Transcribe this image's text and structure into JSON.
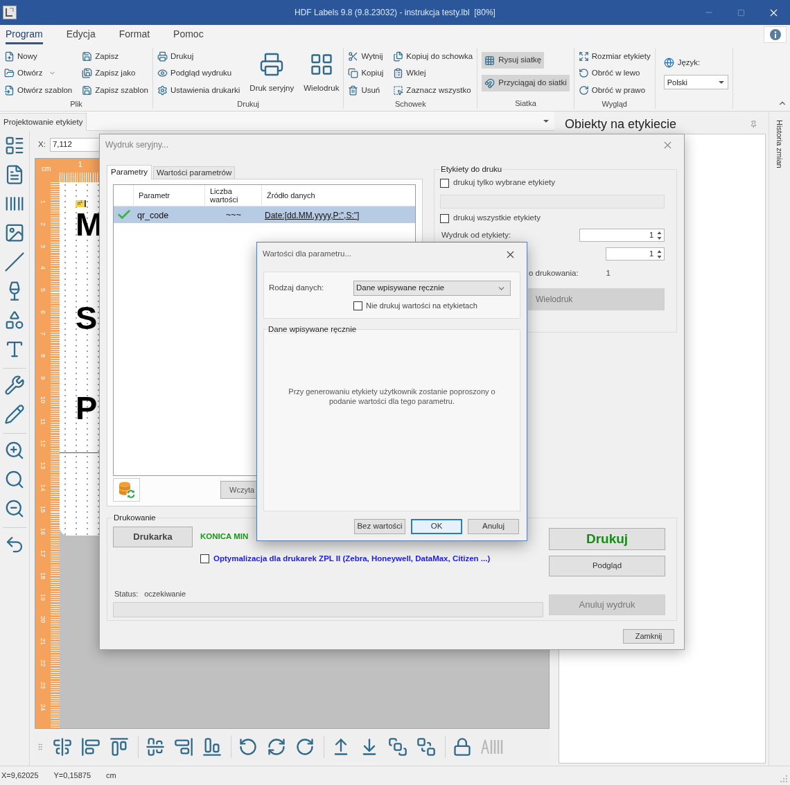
{
  "window": {
    "title": "HDF Labels 9.8 (9.8.23032) - instrukcja testy.lbl  [80%]"
  },
  "menu_tabs": [
    {
      "label": "Program",
      "selected": true
    },
    {
      "label": "Edycja",
      "selected": false
    },
    {
      "label": "Format",
      "selected": false
    },
    {
      "label": "Pomoc",
      "selected": false
    }
  ],
  "ribbon": [
    {
      "label": "Plik",
      "buttons": [
        {
          "kind": "small",
          "label": "Nowy"
        },
        {
          "kind": "split",
          "label": "Otwórz"
        },
        {
          "kind": "small",
          "label": "Otwórz szablon"
        },
        {
          "kind": "small",
          "label": "Zapisz"
        },
        {
          "kind": "small",
          "label": "Zapisz jako"
        },
        {
          "kind": "small",
          "label": "Zapisz szablon"
        }
      ]
    },
    {
      "label": "Drukuj",
      "buttons": [
        {
          "kind": "small",
          "label": "Drukuj"
        },
        {
          "kind": "small",
          "label": "Podgląd wydruku"
        },
        {
          "kind": "small",
          "label": "Ustawienia drukarki"
        },
        {
          "kind": "large",
          "label": "Druk seryjny"
        },
        {
          "kind": "large",
          "label": "Wielodruk"
        }
      ]
    },
    {
      "label": "Schowek",
      "buttons": [
        {
          "kind": "small",
          "label": "Wytnij"
        },
        {
          "kind": "small",
          "label": "Kopiuj"
        },
        {
          "kind": "small",
          "label": "Usuń"
        },
        {
          "kind": "small",
          "label": "Kopiuj do schowka"
        },
        {
          "kind": "small",
          "label": "Wklej"
        },
        {
          "kind": "small",
          "label": "Zaznacz wszystko"
        }
      ]
    },
    {
      "label": "Siatka",
      "buttons": [
        {
          "kind": "toggle",
          "label": "Rysuj siatkę",
          "on": true
        },
        {
          "kind": "toggle",
          "label": "Przyciągaj do siatki",
          "on": true
        }
      ]
    },
    {
      "label": "Wygląd",
      "buttons": [
        {
          "kind": "small",
          "label": "Rozmiar etykiety"
        },
        {
          "kind": "small",
          "label": "Obróć w lewo"
        },
        {
          "kind": "small",
          "label": "Obróć w prawo"
        }
      ]
    }
  ],
  "language": {
    "label": "Język:",
    "value": "Polski"
  },
  "document_tabs": [
    {
      "label": "Projektowanie etykiety",
      "selected": true
    }
  ],
  "coordinates": {
    "label": "X:",
    "value": "7,112"
  },
  "ruler": {
    "unit": "cm",
    "top_marks": [
      "1"
    ],
    "side_marks": [
      "1",
      "2",
      "3",
      "4",
      "5",
      "6",
      "7",
      "8",
      "9",
      "10",
      "11",
      "12",
      "13",
      "14",
      "15",
      "16",
      "17",
      "18",
      "19",
      "20",
      "21",
      "22",
      "23",
      "24"
    ]
  },
  "label_preview": {
    "tag": "rt$^{1}$",
    "lines": [
      "M",
      "S",
      "P"
    ]
  },
  "objects_panel": {
    "title": "Obiekty na etykiecie"
  },
  "side_tabs": [
    {
      "label": "Historia zmian"
    }
  ],
  "serial_print_dialog": {
    "title": "Wydruk seryjny...",
    "tabs": [
      {
        "label": "Parametry",
        "selected": true
      },
      {
        "label": "Wartości parametrów",
        "selected": false
      }
    ],
    "table": {
      "columns": [
        "Parametr",
        "Liczba wartości",
        "Źródło danych"
      ],
      "rows": [
        {
          "valid": true,
          "selected": true,
          "cells": [
            "qr_code",
            "~~~",
            "Date:[dd.MM.yyyy,P:\",S:\"]"
          ]
        }
      ]
    },
    "load_button": "Wczyta",
    "labels_group": {
      "title": "Etykiety do druku",
      "options": [
        {
          "label": "drukuj tylko wybrane etykiety",
          "checked": false
        },
        {
          "label": "drukuj wszystkie etykiety",
          "checked": false
        }
      ],
      "from_label": "Wydruk od etykiety:",
      "from_value": "1",
      "to_value": "1",
      "count_label": "o drukowania:",
      "count_value": "1",
      "multi_button": "Wielodruk"
    },
    "printing_group": {
      "title": "Drukowanie",
      "printer_button": "Drukarka",
      "printer_name": "KONICA MIN",
      "zpl_option": {
        "label": "Optymalizacja dla drukarek ZPL II (Zebra, Honeywell, DataMax, Citizen ...)",
        "checked": false
      },
      "status_label": "Status:",
      "status_value": "oczekiwanie",
      "progress": {
        "level": 0
      }
    },
    "actions": [
      {
        "label": "Drukuj",
        "kind": "primary",
        "disabled": false
      },
      {
        "label": "Podgląd",
        "kind": "normal",
        "disabled": false
      },
      {
        "label": "Anuluj wydruk",
        "kind": "normal",
        "disabled": true
      }
    ],
    "close_button": "Zamknij"
  },
  "parameter_values_dialog": {
    "title": "Wartości dla parametru...",
    "data_type_label": "Rodzaj danych:",
    "data_type_value": "Dane wpisywane ręcznie",
    "no_print_option": {
      "label": "Nie drukuj wartości na etykietach",
      "checked": false
    },
    "section_title": "Dane wpisywane ręcznie",
    "message": "Przy generowaniu etykiety użytkownik zostanie poproszony o podanie wartości dla tego parametru.",
    "buttons": [
      {
        "label": "Bez wartości",
        "focused": false
      },
      {
        "label": "OK",
        "focused": true
      },
      {
        "label": "Anuluj",
        "focused": false
      }
    ]
  },
  "status_bar": [
    "X=9,62025",
    "Y=0,15875",
    "cm"
  ]
}
